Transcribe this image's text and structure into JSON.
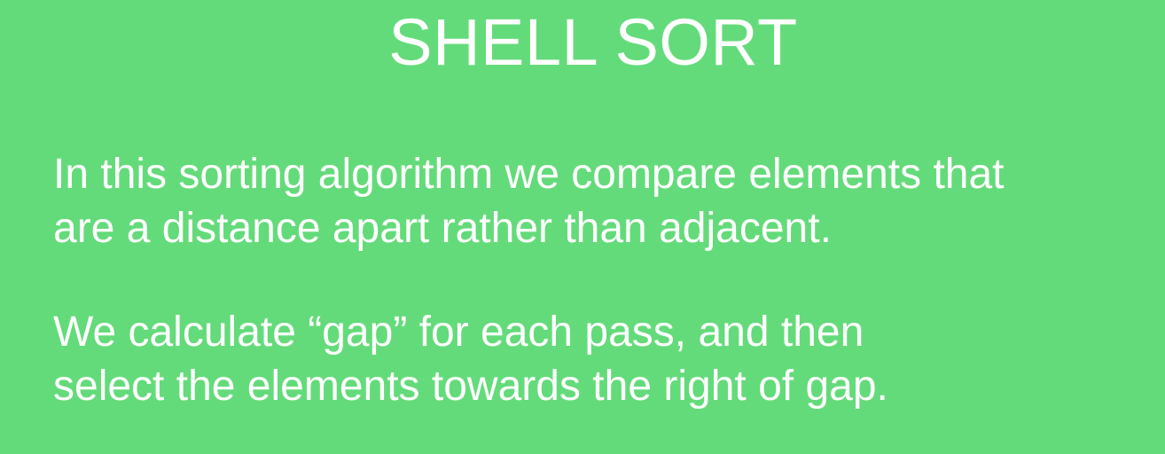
{
  "slide": {
    "title": "SHELL SORT",
    "paragraphs": [
      {
        "lines": [
          "In this sorting algorithm we compare elements that",
          "are a distance apart rather than adjacent."
        ]
      },
      {
        "lines": [
          "We calculate “gap” for each pass, and then",
          "select the elements towards the right of gap."
        ]
      }
    ]
  },
  "colors": {
    "background": "#64db7a",
    "text": "#ffffff"
  }
}
